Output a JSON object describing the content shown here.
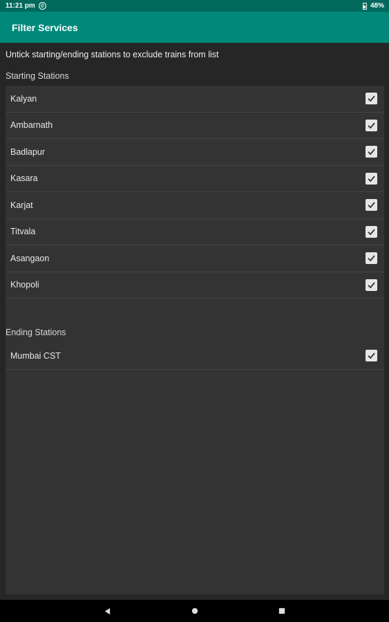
{
  "status_bar": {
    "time": "11:21 pm",
    "battery": "48%"
  },
  "app_bar": {
    "title": "Filter Services"
  },
  "hint": "Untick starting/ending stations to exclude trains from list",
  "starting": {
    "title": "Starting Stations",
    "items": [
      {
        "label": "Kalyan",
        "checked": true
      },
      {
        "label": "Ambarnath",
        "checked": true
      },
      {
        "label": "Badlapur",
        "checked": true
      },
      {
        "label": "Kasara",
        "checked": true
      },
      {
        "label": "Karjat",
        "checked": true
      },
      {
        "label": "Titvala",
        "checked": true
      },
      {
        "label": "Asangaon",
        "checked": true
      },
      {
        "label": "Khopoli",
        "checked": true
      }
    ]
  },
  "ending": {
    "title": "Ending Stations",
    "items": [
      {
        "label": "Mumbai CST",
        "checked": true
      }
    ]
  }
}
